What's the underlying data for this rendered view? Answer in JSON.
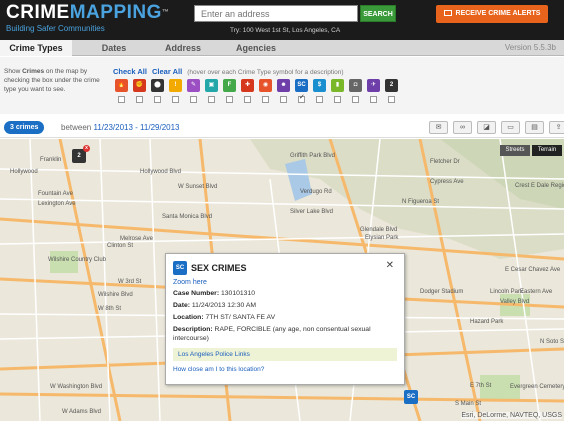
{
  "header": {
    "logo_crime": "CRIME",
    "logo_mapping": "MAPPING",
    "logo_tm": "™",
    "tagline": "Building Safer Communities",
    "search_placeholder": "Enter an address",
    "search_button": "SEARCH",
    "search_hint": "Try: 100 West 1st St, Los Angeles, CA",
    "alerts_button": "RECEIVE CRIME ALERTS"
  },
  "tabs": [
    {
      "label": "Crime Types",
      "active": true
    },
    {
      "label": "Dates",
      "active": false
    },
    {
      "label": "Address",
      "active": false
    },
    {
      "label": "Agencies",
      "active": false
    }
  ],
  "version": "Version 5.5.3b",
  "filters": {
    "help_text_1": "Show ",
    "help_bold": "Crimes",
    "help_text_2": " on the map by checking the box under the crime type you want to see.",
    "check_all": "Check All",
    "clear_all": "Clear All",
    "hover_hint": "(hover over each Crime Type symbol for a description)",
    "icons": [
      {
        "name": "arson-icon",
        "glyph": "🔥",
        "color": "#e7532a",
        "checked": false
      },
      {
        "name": "assault-icon",
        "glyph": "✊",
        "color": "#d6381e",
        "checked": false
      },
      {
        "name": "burglary-icon",
        "glyph": "⬤",
        "color": "#333333",
        "checked": false
      },
      {
        "name": "disturbing-peace-icon",
        "glyph": "!",
        "color": "#f2a900",
        "checked": false
      },
      {
        "name": "drugs-icon",
        "glyph": "✎",
        "color": "#9c4fc2",
        "checked": false
      },
      {
        "name": "dui-icon",
        "glyph": "▣",
        "color": "#23a7a8",
        "checked": false
      },
      {
        "name": "fraud-icon",
        "glyph": "F",
        "color": "#42a84a",
        "checked": false
      },
      {
        "name": "homicide-icon",
        "glyph": "✚",
        "color": "#d6381e",
        "checked": false
      },
      {
        "name": "motor-vehicle-theft-icon",
        "glyph": "◉",
        "color": "#e7532a",
        "checked": false
      },
      {
        "name": "robbery-icon",
        "glyph": "☻",
        "color": "#6e3fa8",
        "checked": false
      },
      {
        "name": "sex-crimes-icon",
        "glyph": "SC",
        "color": "#1a6ec4",
        "checked": true
      },
      {
        "name": "theft-icon",
        "glyph": "$",
        "color": "#1a8fd0",
        "checked": false
      },
      {
        "name": "vandalism-icon",
        "glyph": "▮",
        "color": "#7ab82a",
        "checked": false
      },
      {
        "name": "vehicle-break-in-icon",
        "glyph": "◘",
        "color": "#666666",
        "checked": false
      },
      {
        "name": "weapons-icon",
        "glyph": "✈",
        "color": "#6e3fa8",
        "checked": false
      },
      {
        "name": "other-icon",
        "glyph": "2",
        "color": "#333333",
        "checked": false
      }
    ]
  },
  "results": {
    "count_label": "3 crimes",
    "between_label": "between",
    "date_range": "11/23/2013 - 11/29/2013"
  },
  "tools": [
    {
      "name": "email-icon",
      "glyph": "✉"
    },
    {
      "name": "link-icon",
      "glyph": "∞"
    },
    {
      "name": "chart-icon",
      "glyph": "◪"
    },
    {
      "name": "window-icon",
      "glyph": "▭"
    },
    {
      "name": "print-icon",
      "glyph": "▤"
    },
    {
      "name": "share-icon",
      "glyph": "⇪"
    }
  ],
  "map": {
    "streets_label": "Streets",
    "terrain_label": "Terrain",
    "labels": [
      "Franklin",
      "Hollywood",
      "Hollywood Blvd",
      "W Sunset Blvd",
      "Fountain Ave",
      "Lexington Ave",
      "Santa Monica Blvd",
      "Melrose Ave",
      "Clinton St",
      "Wilshire Country Club",
      "W 3rd St",
      "Wilshire Blvd",
      "W 8th St",
      "W Washington Blvd",
      "W Adams Blvd",
      "Griffith Park Blvd",
      "Glendale Blvd",
      "Fletcher Dr",
      "Cypress Ave",
      "Dodger Stadium",
      "Lincoln Park",
      "Hazard Park",
      "Eastern Ave",
      "Valley Blvd",
      "S Main St",
      "E 7th St",
      "Evergreen Cemetery",
      "Elysian Park",
      "Crest E Dale Regional Park",
      "Silver Lake Blvd",
      "N Figueroa St",
      "Verdugo Rd",
      "N Soto St",
      "E Cesar Chavez Ave"
    ],
    "attribution": "Esri, DeLorme, NAVTEQ, USGS"
  },
  "popup": {
    "badge": "SC",
    "title": "SEX CRIMES",
    "zoom": "Zoom here",
    "case_label": "Case Number:",
    "case_value": "130101310",
    "date_label": "Date:",
    "date_value": "11/24/2013 12:30 AM",
    "location_label": "Location:",
    "location_value": "7TH ST/ SANTA FE AV",
    "desc_label": "Description:",
    "desc_value": "RAPE, FORCIBLE (any age, non consentual sexual intercourse)",
    "agency_link": "Los Angeles Police Links",
    "close_q": "How close am I to this location?",
    "close_x": "✕"
  },
  "markers": [
    {
      "name": "cluster-marker",
      "glyph": "2",
      "color": "#333333"
    },
    {
      "name": "sex-crimes-marker",
      "glyph": "SC",
      "color": "#1a6ec4"
    }
  ]
}
